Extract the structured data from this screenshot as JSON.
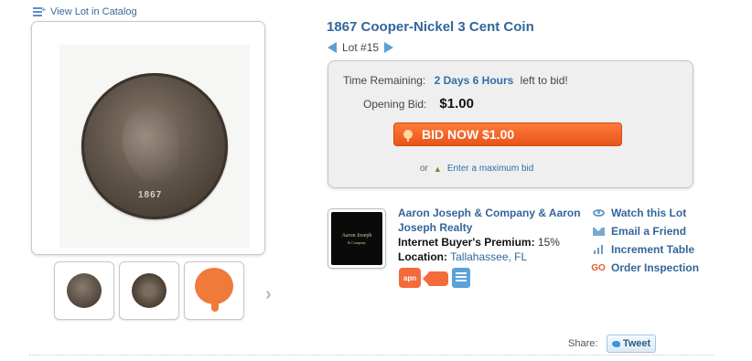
{
  "catalog_link": {
    "label": "View Lot in Catalog",
    "icon": "list-icon"
  },
  "images": {
    "main_alt": "1867 Cooper-Nickel 3 Cent Coin photo",
    "coin_date": "1867",
    "thumbs": [
      "coin-obverse",
      "coin-reverse",
      "speech-bubble-icon"
    ]
  },
  "lot": {
    "title": "1867 Cooper-Nickel 3 Cent Coin",
    "label": "Lot #15"
  },
  "bid": {
    "time_label": "Time Remaining:",
    "time_value": "2 Days 6 Hours",
    "time_suffix": "left to bid!",
    "opening_label": "Opening Bid:",
    "opening_value": "$1.00",
    "button_label": "BID NOW $1.00",
    "or_label": "or",
    "max_bid_label": "Enter a maximum bid"
  },
  "seller": {
    "name": "Aaron Joseph & Company & Aaron Joseph Realty",
    "premium_label": "Internet Buyer's Premium:",
    "premium_value": "15%",
    "location_label": "Location:",
    "location_value": "Tallahassee, FL",
    "logo_line1": "Aaron Joseph",
    "logo_line2": "& Company",
    "badges": {
      "apn": "apn"
    }
  },
  "actions": [
    {
      "label": "Watch this Lot",
      "icon": "eye-icon"
    },
    {
      "label": "Email a Friend",
      "icon": "mail-icon"
    },
    {
      "label": "Increment Table",
      "icon": "bar-chart-icon"
    },
    {
      "label": "Order Inspection",
      "icon": "go-icon",
      "icon_text": "GO"
    }
  ],
  "share": {
    "label": "Share:",
    "tweet": "Tweet"
  },
  "colors": {
    "link": "#336699",
    "bid_button": "#f06a2a",
    "badge_orange": "#f36b3b",
    "badge_blue": "#5aa2d8"
  }
}
